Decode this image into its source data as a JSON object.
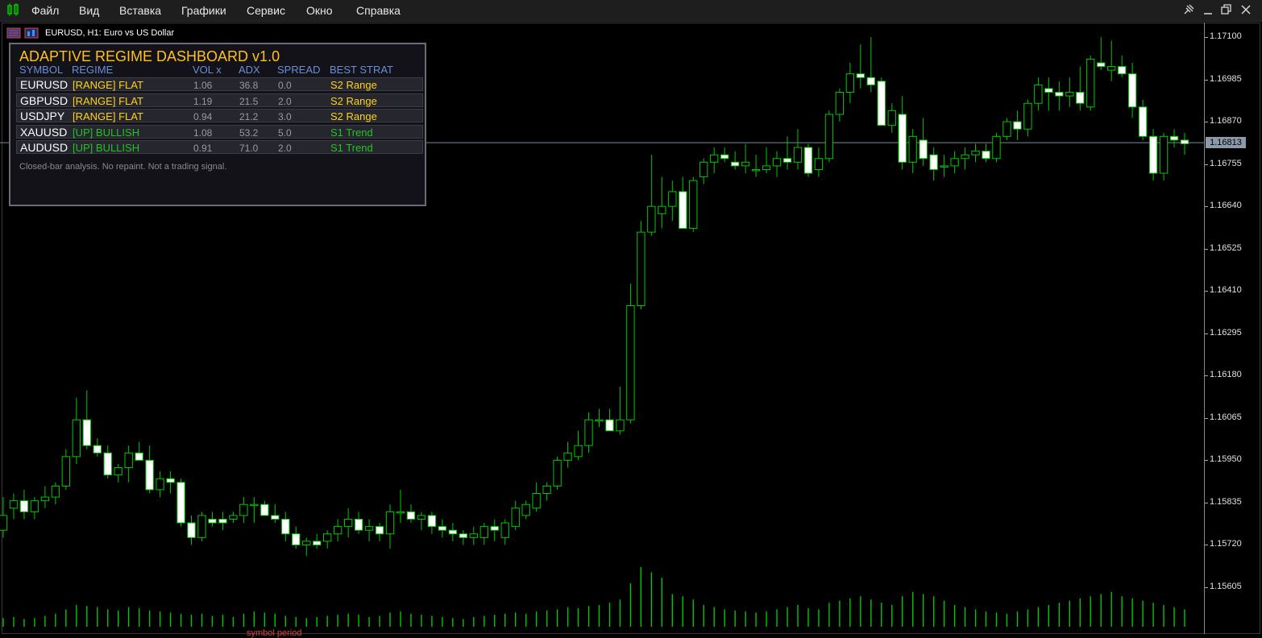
{
  "menu": {
    "items": [
      "Файл",
      "Вид",
      "Вставка",
      "Графики",
      "Сервис",
      "Окно",
      "Справка"
    ]
  },
  "window_controls": [
    "pin-icon",
    "minimize-icon",
    "restore-icon",
    "close-icon"
  ],
  "chart": {
    "title": "EURUSD, H1:  Euro vs US Dollar",
    "current_price": "1.16813",
    "price_labels": [
      "1.17100",
      "1.16985",
      "1.16870",
      "1.16755",
      "1.16640",
      "1.16525",
      "1.16410",
      "1.16295",
      "1.16180",
      "1.16065",
      "1.15950",
      "1.15835",
      "1.15720",
      "1.15605"
    ],
    "time_tab_label": "symbol period",
    "colors": {
      "bull": "#00c800",
      "bear_body": "#ffffff",
      "bg": "#000000",
      "accent": "#ffc21a"
    }
  },
  "chart_data": {
    "type": "candlestick",
    "symbol": "EURUSD",
    "timeframe": "H1",
    "ylim": [
      1.1555,
      1.172
    ],
    "y_ticks": [
      1.171,
      1.16985,
      1.1687,
      1.16755,
      1.1664,
      1.16525,
      1.1641,
      1.16295,
      1.1618,
      1.16065,
      1.1595,
      1.15835,
      1.1572,
      1.15605
    ],
    "current_price": 1.16813,
    "candles": [
      [
        1.1576,
        1.1585,
        1.1574,
        1.158
      ],
      [
        1.1582,
        1.1586,
        1.1579,
        1.1584
      ],
      [
        1.1584,
        1.1587,
        1.1579,
        1.1581
      ],
      [
        1.1581,
        1.1585,
        1.1579,
        1.1584
      ],
      [
        1.1584,
        1.1588,
        1.1582,
        1.1585
      ],
      [
        1.1585,
        1.1589,
        1.1583,
        1.1588
      ],
      [
        1.1588,
        1.1598,
        1.1587,
        1.1596
      ],
      [
        1.1596,
        1.1612,
        1.1594,
        1.1606
      ],
      [
        1.1606,
        1.1614,
        1.1598,
        1.1599
      ],
      [
        1.1599,
        1.1601,
        1.1596,
        1.1597
      ],
      [
        1.1597,
        1.1599,
        1.159,
        1.1591
      ],
      [
        1.1591,
        1.1594,
        1.1589,
        1.1593
      ],
      [
        1.1593,
        1.1599,
        1.1589,
        1.1597
      ],
      [
        1.1597,
        1.16,
        1.1595,
        1.1595
      ],
      [
        1.1595,
        1.1599,
        1.1586,
        1.1587
      ],
      [
        1.1587,
        1.1592,
        1.1585,
        1.159
      ],
      [
        1.159,
        1.1592,
        1.1586,
        1.1589
      ],
      [
        1.1589,
        1.159,
        1.1577,
        1.1578
      ],
      [
        1.1578,
        1.158,
        1.1572,
        1.1574
      ],
      [
        1.1574,
        1.1581,
        1.1573,
        1.158
      ],
      [
        1.1579,
        1.1581,
        1.1577,
        1.1578
      ],
      [
        1.1579,
        1.1581,
        1.1576,
        1.1578
      ],
      [
        1.1579,
        1.1581,
        1.1578,
        1.158
      ],
      [
        1.158,
        1.1585,
        1.1578,
        1.1583
      ],
      [
        1.1583,
        1.1585,
        1.1578,
        1.1583
      ],
      [
        1.1583,
        1.1584,
        1.1581,
        1.158
      ],
      [
        1.158,
        1.1583,
        1.1578,
        1.1579
      ],
      [
        1.1579,
        1.1581,
        1.1573,
        1.1575
      ],
      [
        1.1575,
        1.1577,
        1.1571,
        1.1572
      ],
      [
        1.1572,
        1.1574,
        1.1569,
        1.1573
      ],
      [
        1.1573,
        1.1575,
        1.1571,
        1.1572
      ],
      [
        1.1573,
        1.1576,
        1.1571,
        1.1575
      ],
      [
        1.1575,
        1.1579,
        1.1573,
        1.1577
      ],
      [
        1.1577,
        1.1582,
        1.1574,
        1.1579
      ],
      [
        1.1579,
        1.1581,
        1.1575,
        1.1576
      ],
      [
        1.1576,
        1.1579,
        1.1573,
        1.1577
      ],
      [
        1.1577,
        1.1578,
        1.1573,
        1.1575
      ],
      [
        1.1575,
        1.1583,
        1.1571,
        1.1581
      ],
      [
        1.1581,
        1.1587,
        1.1578,
        1.1581
      ],
      [
        1.1581,
        1.1583,
        1.1578,
        1.1579
      ],
      [
        1.1579,
        1.1581,
        1.1576,
        1.158
      ],
      [
        1.158,
        1.1581,
        1.1575,
        1.1577
      ],
      [
        1.1577,
        1.1579,
        1.1574,
        1.1576
      ],
      [
        1.1576,
        1.1578,
        1.1573,
        1.1575
      ],
      [
        1.1575,
        1.1576,
        1.1572,
        1.1574
      ],
      [
        1.1574,
        1.1577,
        1.1572,
        1.1575
      ],
      [
        1.1574,
        1.1578,
        1.1572,
        1.1577
      ],
      [
        1.1577,
        1.1579,
        1.1573,
        1.1576
      ],
      [
        1.1574,
        1.1579,
        1.1572,
        1.1578
      ],
      [
        1.1577,
        1.1584,
        1.1576,
        1.1582
      ],
      [
        1.158,
        1.1584,
        1.1579,
        1.1583
      ],
      [
        1.1582,
        1.1589,
        1.1581,
        1.1586
      ],
      [
        1.1586,
        1.1589,
        1.1584,
        1.1588
      ],
      [
        1.1588,
        1.1596,
        1.1587,
        1.1595
      ],
      [
        1.1595,
        1.16,
        1.1593,
        1.1597
      ],
      [
        1.1596,
        1.1603,
        1.1595,
        1.1599
      ],
      [
        1.1599,
        1.1608,
        1.1597,
        1.1606
      ],
      [
        1.1606,
        1.1609,
        1.1604,
        1.1606
      ],
      [
        1.1606,
        1.1609,
        1.1603,
        1.1603
      ],
      [
        1.1603,
        1.1615,
        1.1602,
        1.1606
      ],
      [
        1.1606,
        1.1643,
        1.1605,
        1.1637
      ],
      [
        1.1637,
        1.166,
        1.1636,
        1.1657
      ],
      [
        1.1657,
        1.1678,
        1.1656,
        1.1664
      ],
      [
        1.1662,
        1.1672,
        1.1658,
        1.1664
      ],
      [
        1.1664,
        1.1671,
        1.166,
        1.1668
      ],
      [
        1.1668,
        1.1672,
        1.1658,
        1.1658
      ],
      [
        1.1658,
        1.1672,
        1.1657,
        1.1671
      ],
      [
        1.1672,
        1.1677,
        1.167,
        1.1676
      ],
      [
        1.1676,
        1.168,
        1.1673,
        1.1678
      ],
      [
        1.1678,
        1.168,
        1.1676,
        1.1677
      ],
      [
        1.1676,
        1.1679,
        1.1674,
        1.1675
      ],
      [
        1.1675,
        1.1681,
        1.1673,
        1.1676
      ],
      [
        1.1674,
        1.1678,
        1.1672,
        1.1674
      ],
      [
        1.1674,
        1.168,
        1.1673,
        1.1675
      ],
      [
        1.1675,
        1.1679,
        1.1672,
        1.1677
      ],
      [
        1.1677,
        1.1683,
        1.1674,
        1.1676
      ],
      [
        1.1676,
        1.1685,
        1.1674,
        1.168
      ],
      [
        1.168,
        1.1681,
        1.1672,
        1.1673
      ],
      [
        1.1674,
        1.168,
        1.1672,
        1.1677
      ],
      [
        1.1677,
        1.169,
        1.1676,
        1.1689
      ],
      [
        1.1689,
        1.1696,
        1.1687,
        1.1695
      ],
      [
        1.1695,
        1.1703,
        1.1692,
        1.17
      ],
      [
        1.17,
        1.1708,
        1.1696,
        1.1699
      ],
      [
        1.1699,
        1.171,
        1.1695,
        1.1697
      ],
      [
        1.1698,
        1.1699,
        1.1686,
        1.1686
      ],
      [
        1.1686,
        1.1692,
        1.1684,
        1.169
      ],
      [
        1.1689,
        1.1694,
        1.1674,
        1.1676
      ],
      [
        1.1676,
        1.1685,
        1.1673,
        1.1683
      ],
      [
        1.1682,
        1.1688,
        1.1675,
        1.1677
      ],
      [
        1.1678,
        1.168,
        1.1671,
        1.1674
      ],
      [
        1.1675,
        1.1678,
        1.1672,
        1.1675
      ],
      [
        1.1675,
        1.1679,
        1.1673,
        1.1677
      ],
      [
        1.1677,
        1.168,
        1.1674,
        1.1678
      ],
      [
        1.1678,
        1.1681,
        1.1676,
        1.1679
      ],
      [
        1.1679,
        1.1681,
        1.1676,
        1.1677
      ],
      [
        1.1677,
        1.1684,
        1.1676,
        1.1683
      ],
      [
        1.1683,
        1.1688,
        1.1682,
        1.1687
      ],
      [
        1.1687,
        1.169,
        1.1682,
        1.1685
      ],
      [
        1.1685,
        1.1693,
        1.1683,
        1.1692
      ],
      [
        1.1692,
        1.1699,
        1.169,
        1.1697
      ],
      [
        1.1696,
        1.1699,
        1.169,
        1.1695
      ],
      [
        1.1695,
        1.1698,
        1.169,
        1.1694
      ],
      [
        1.1694,
        1.1699,
        1.1691,
        1.1695
      ],
      [
        1.1695,
        1.1702,
        1.169,
        1.1692
      ],
      [
        1.1691,
        1.1705,
        1.169,
        1.1704
      ],
      [
        1.1703,
        1.171,
        1.1701,
        1.1702
      ],
      [
        1.1701,
        1.1709,
        1.1698,
        1.1702
      ],
      [
        1.1702,
        1.1705,
        1.1699,
        1.17
      ],
      [
        1.17,
        1.1703,
        1.1688,
        1.1691
      ],
      [
        1.1691,
        1.1693,
        1.1682,
        1.1683
      ],
      [
        1.1683,
        1.1685,
        1.1671,
        1.1673
      ],
      [
        1.1673,
        1.1684,
        1.1671,
        1.1683
      ],
      [
        1.1683,
        1.1685,
        1.168,
        1.1682
      ],
      [
        1.1682,
        1.1684,
        1.1678,
        1.1681
      ]
    ],
    "volumes": [
      8,
      9,
      7,
      8,
      10,
      12,
      16,
      20,
      19,
      18,
      16,
      15,
      18,
      17,
      15,
      14,
      13,
      12,
      11,
      12,
      10,
      11,
      9,
      12,
      14,
      13,
      12,
      10,
      9,
      8,
      9,
      10,
      11,
      12,
      11,
      9,
      10,
      13,
      14,
      12,
      11,
      10,
      9,
      8,
      7,
      9,
      10,
      11,
      12,
      13,
      12,
      14,
      15,
      16,
      18,
      17,
      19,
      20,
      22,
      25,
      40,
      55,
      50,
      45,
      30,
      28,
      25,
      20,
      18,
      16,
      15,
      14,
      13,
      14,
      16,
      18,
      20,
      17,
      16,
      22,
      24,
      26,
      28,
      25,
      22,
      20,
      28,
      32,
      30,
      28,
      24,
      20,
      18,
      16,
      14,
      13,
      12,
      14,
      16,
      18,
      20,
      22,
      24,
      26,
      28,
      30,
      32,
      28,
      26,
      24,
      22,
      20,
      18,
      16
    ]
  },
  "dashboard": {
    "title": "ADAPTIVE REGIME DASHBOARD v1.0",
    "headers": [
      "SYMBOL",
      "REGIME",
      "VOL x",
      "ADX",
      "SPREAD",
      "BEST STRAT"
    ],
    "rows": [
      {
        "symbol": "EURUSD",
        "regime": "[RANGE] FLAT",
        "regime_color": "#ffd21a",
        "vol": "1.06",
        "adx": "36.8",
        "spread": "0.0",
        "strat": "S2 Range",
        "strat_color": "#ffd21a"
      },
      {
        "symbol": "GBPUSD",
        "regime": "[RANGE] FLAT",
        "regime_color": "#ffd21a",
        "vol": "1.19",
        "adx": "21.5",
        "spread": "2.0",
        "strat": "S2 Range",
        "strat_color": "#ffd21a"
      },
      {
        "symbol": "USDJPY",
        "regime": "[RANGE] FLAT",
        "regime_color": "#ffd21a",
        "vol": "0.94",
        "adx": "21.2",
        "spread": "3.0",
        "strat": "S2 Range",
        "strat_color": "#ffd21a"
      },
      {
        "symbol": "XAUUSD",
        "regime": "[UP] BULLISH",
        "regime_color": "#22c422",
        "vol": "1.08",
        "adx": "53.2",
        "spread": "5.0",
        "strat": "S1 Trend",
        "strat_color": "#22c422"
      },
      {
        "symbol": "AUDUSD",
        "regime": "[UP] BULLISH",
        "regime_color": "#22c422",
        "vol": "0.91",
        "adx": "71.0",
        "spread": "2.0",
        "strat": "S1 Trend",
        "strat_color": "#22c422"
      }
    ],
    "footer": "Closed-bar analysis. No repaint. Not a trading signal."
  }
}
